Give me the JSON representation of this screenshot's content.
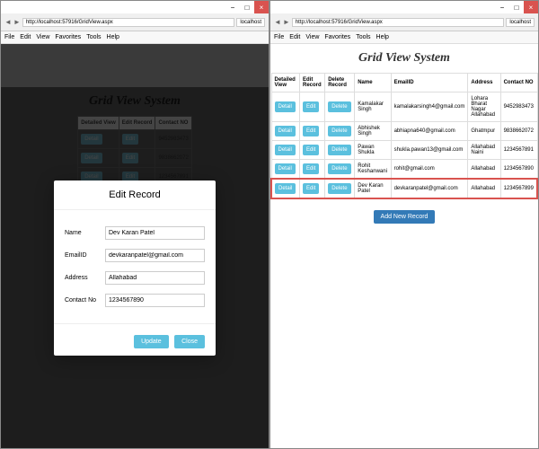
{
  "browser": {
    "url": "http://localhost:57916/GridView.aspx",
    "tab": "localhost",
    "menu": [
      "File",
      "Edit",
      "View",
      "Favorites",
      "Tools",
      "Help"
    ]
  },
  "page": {
    "title": "Grid View System"
  },
  "columns": [
    "Detailed View",
    "Edit Record",
    "Delete Record",
    "Name",
    "EmailID",
    "Address",
    "Contact NO"
  ],
  "buttons": {
    "detail": "Detail",
    "edit": "Edit",
    "delete": "Delete",
    "update": "Update",
    "close": "Close",
    "addNew": "Add New Record"
  },
  "rows": [
    {
      "name": "Kamalakar Singh",
      "email": "kamalakarsingh4@gmail.com",
      "address": "Lohara Bharat Nagar Allahabad",
      "contact": "9452983473"
    },
    {
      "name": "Abhishek Singh",
      "email": "abhiapna640@gmail.com",
      "address": "Ghatmpur",
      "contact": "9838662072"
    },
    {
      "name": "Pawan Shukla",
      "email": "shukla.pawan13@gmail.com",
      "address": "Allahabad Naini",
      "contact": "1234567891"
    },
    {
      "name": "Rohit Keshanwani",
      "email": "rohit@gmail.com",
      "address": "Allahabad",
      "contact": "1234567890"
    },
    {
      "name": "Dev Karan Patel",
      "email": "devkaranpatel@gmail.com",
      "address": "Allahabad",
      "contact": "1234567899"
    }
  ],
  "modal": {
    "title": "Edit Record",
    "fields": {
      "name": {
        "label": "Name",
        "value": "Dev Karan Patel"
      },
      "email": {
        "label": "EmailID",
        "value": "devkaranpatel@gmail.com"
      },
      "address": {
        "label": "Address",
        "value": "Allahabad"
      },
      "contact": {
        "label": "Contact No",
        "value": "1234567890"
      }
    }
  }
}
